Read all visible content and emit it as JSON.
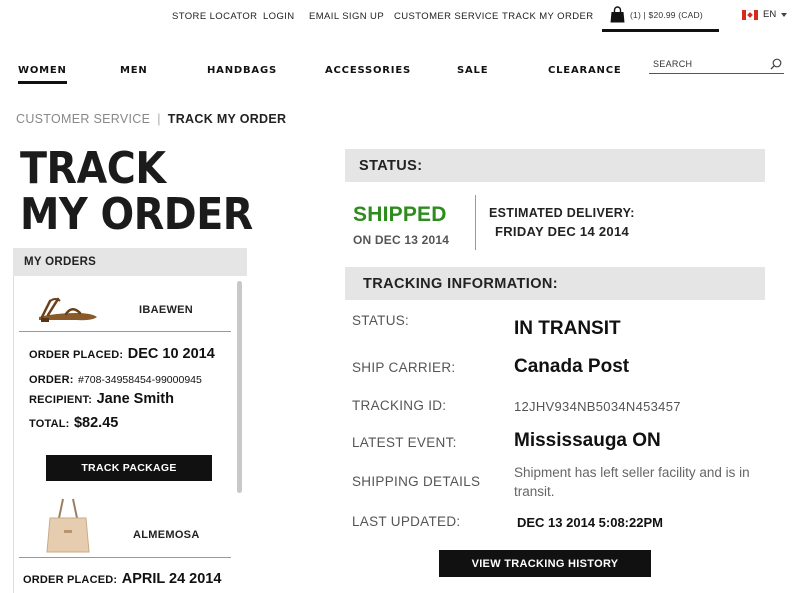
{
  "utility_nav": {
    "store_locator": "STORE LOCATOR",
    "login": "LOGIN",
    "email_signup": "EMAIL SIGN UP",
    "customer_service": "CUSTOMER SERVICE",
    "track_my_order": "TRACK MY ORDER",
    "bag_summary": "(1) | $20.99 (CAD)",
    "language": "EN"
  },
  "main_nav": {
    "women": "WOMEN",
    "men": "MEN",
    "handbags": "HANDBAGS",
    "accessories": "ACCESSORIES",
    "sale": "SALE",
    "clearance": "CLEARANCE",
    "active": "WOMEN"
  },
  "search": {
    "placeholder": "SEARCH"
  },
  "breadcrumb": {
    "parent": "CUSTOMER SERVICE",
    "separator": "|",
    "current": "TRACK MY ORDER"
  },
  "page_title": {
    "line1": "TRACK",
    "line2": "MY ORDER"
  },
  "my_orders": {
    "heading": "MY ORDERS",
    "orders": [
      {
        "name": "IBAEWEN",
        "order_placed_label": "ORDER PLACED:",
        "order_placed": "DEC 10 2014",
        "order_label": "ORDER:",
        "order_number": "#708-34958454-99000945",
        "recipient_label": "RECIPIENT:",
        "recipient": "Jane Smith",
        "total_label": "TOTAL:",
        "total": "$82.45",
        "button": "TRACK PACKAGE"
      },
      {
        "name": "ALMEMOSA",
        "order_placed_label": "ORDER PLACED:",
        "order_placed": "APRIL 24 2014"
      }
    ]
  },
  "status": {
    "heading": "STATUS:",
    "state": "SHIPPED",
    "state_date": "ON DEC 13 2014",
    "estimated_label": "ESTIMATED DELIVERY:",
    "estimated_date": "FRIDAY DEC 14 2014"
  },
  "tracking": {
    "heading": "TRACKING INFORMATION:",
    "status_label": "STATUS:",
    "status_value": "IN TRANSIT",
    "carrier_label": "SHIP CARRIER:",
    "carrier_value": "Canada Post",
    "id_label": "TRACKING ID:",
    "id_value": "12JHV934NB5034N453457",
    "event_label": "LATEST EVENT:",
    "event_value": "Mississauga ON",
    "details_label": "SHIPPING DETAILS",
    "details_value": "Shipment has left seller facility and is in transit.",
    "updated_label": "LAST UPDATED:",
    "updated_value": "DEC 13 2014 5:08:22PM",
    "history_button": "VIEW TRACKING HISTORY"
  },
  "colors": {
    "shipped_green": "#2e8b1e",
    "bar_gray": "#e5e5e5",
    "button_black": "#111111"
  }
}
